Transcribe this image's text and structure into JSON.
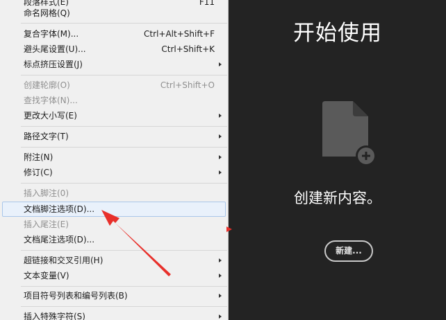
{
  "menu": {
    "items": [
      {
        "label": "段落样式(E)",
        "shortcut": "F11",
        "disabled": false,
        "submenu": false
      },
      {
        "label": "命名网格(Q)",
        "shortcut": "",
        "disabled": false,
        "submenu": false
      },
      {
        "label": "复合字体(M)...",
        "shortcut": "Ctrl+Alt+Shift+F",
        "disabled": false,
        "submenu": false
      },
      {
        "label": "避头尾设置(U)...",
        "shortcut": "Ctrl+Shift+K",
        "disabled": false,
        "submenu": false
      },
      {
        "label": "标点挤压设置(J)",
        "shortcut": "",
        "disabled": false,
        "submenu": true
      },
      {
        "label": "创建轮廓(O)",
        "shortcut": "Ctrl+Shift+O",
        "disabled": true,
        "submenu": false
      },
      {
        "label": "查找字体(N)...",
        "shortcut": "",
        "disabled": true,
        "submenu": false
      },
      {
        "label": "更改大小写(E)",
        "shortcut": "",
        "disabled": false,
        "submenu": true
      },
      {
        "label": "路径文字(T)",
        "shortcut": "",
        "disabled": false,
        "submenu": true
      },
      {
        "label": "附注(N)",
        "shortcut": "",
        "disabled": false,
        "submenu": true
      },
      {
        "label": "修订(C)",
        "shortcut": "",
        "disabled": false,
        "submenu": true
      },
      {
        "label": "插入脚注(0)",
        "shortcut": "",
        "disabled": true,
        "submenu": false
      },
      {
        "label": "文档脚注选项(D)...",
        "shortcut": "",
        "disabled": false,
        "submenu": false,
        "highlighted": true
      },
      {
        "label": "插入尾注(E)",
        "shortcut": "",
        "disabled": true,
        "submenu": false
      },
      {
        "label": "文档尾注选项(D)...",
        "shortcut": "",
        "disabled": false,
        "submenu": false
      },
      {
        "label": "超链接和交叉引用(H)",
        "shortcut": "",
        "disabled": false,
        "submenu": true
      },
      {
        "label": "文本变量(V)",
        "shortcut": "",
        "disabled": false,
        "submenu": true
      },
      {
        "label": "项目符号列表和编号列表(B)",
        "shortcut": "",
        "disabled": false,
        "submenu": true
      },
      {
        "label": "插入特殊字符(S)",
        "shortcut": "",
        "disabled": false,
        "submenu": true
      }
    ]
  },
  "start_panel": {
    "title": "开始使用",
    "create_text": "创建新内容。",
    "new_button_label": "新建..."
  },
  "colors": {
    "menu_bg": "#f0f0f0",
    "panel_bg": "#232323",
    "annotation_red": "#e8302b",
    "highlight_bg": "#e9f1fb"
  },
  "icons": {
    "new_document": "new-document-icon",
    "submenu": "chevron-right-icon",
    "annotation": "red-arrow-annotation"
  }
}
